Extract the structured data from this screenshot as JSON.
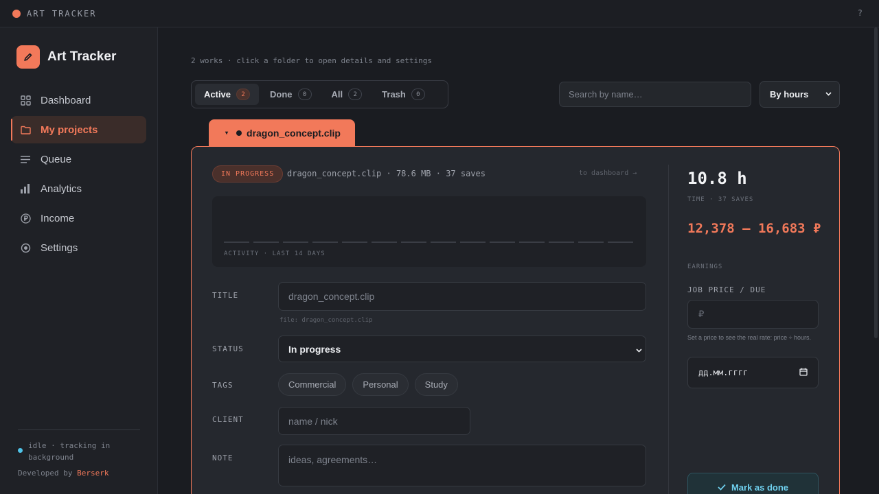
{
  "titlebar": {
    "title": "ART TRACKER",
    "help": "?"
  },
  "brand": {
    "name": "Art Tracker"
  },
  "nav": [
    {
      "label": "Dashboard",
      "icon": "grid-icon"
    },
    {
      "label": "My projects",
      "icon": "folder-icon",
      "active": true
    },
    {
      "label": "Queue",
      "icon": "list-icon"
    },
    {
      "label": "Analytics",
      "icon": "bar-chart-icon"
    },
    {
      "label": "Income",
      "icon": "ruble-circle-icon"
    },
    {
      "label": "Settings",
      "icon": "settings-icon"
    }
  ],
  "sidebar_footer": {
    "status": "idle · tracking in background",
    "developed_by": "Developed by",
    "developer": "Berserk"
  },
  "main": {
    "subtitle": "2 works · click a folder to open details and settings",
    "tabs": [
      {
        "label": "Active",
        "count": "2",
        "active": true
      },
      {
        "label": "Done",
        "count": "0"
      },
      {
        "label": "All",
        "count": "2"
      },
      {
        "label": "Trash",
        "count": "0"
      }
    ],
    "search_placeholder": "Search by name…",
    "sort_value": "By hours"
  },
  "project": {
    "folder_caret": "▾",
    "name": "dragon_concept.clip",
    "status_badge": "IN PROGRESS",
    "meta": "dragon_concept.clip · 78.6 MB · 37 saves",
    "to_dashboard": "to dashboard →",
    "activity_label": "ACTIVITY · LAST 14 DAYS",
    "activity_days": 14,
    "fields": {
      "title_label": "TITLE",
      "title_placeholder": "dragon_concept.clip",
      "file_note": "file: dragon_concept.clip",
      "status_label": "STATUS",
      "status_value": "In progress",
      "tags_label": "TAGS",
      "tags": [
        "Commercial",
        "Personal",
        "Study"
      ],
      "client_label": "CLIENT",
      "client_placeholder": "name / nick",
      "note_label": "NOTE",
      "note_placeholder": "ideas, agreements…"
    },
    "stats": {
      "hours": "10.8 h",
      "hours_sub": "TIME · 37 SAVES",
      "earnings": "12,378 – 16,683 ₽",
      "earnings_sub": "EARNINGS",
      "price_label": "JOB PRICE / DUE",
      "price_placeholder": "₽",
      "price_hint": "Set a price to see the real rate: price ÷ hours.",
      "date_placeholder": "дд.мм.гггг",
      "done_button": "Mark as done"
    }
  },
  "colors": {
    "accent": "#f2795a",
    "info": "#4fc3e8",
    "background": "#1a1c21"
  }
}
